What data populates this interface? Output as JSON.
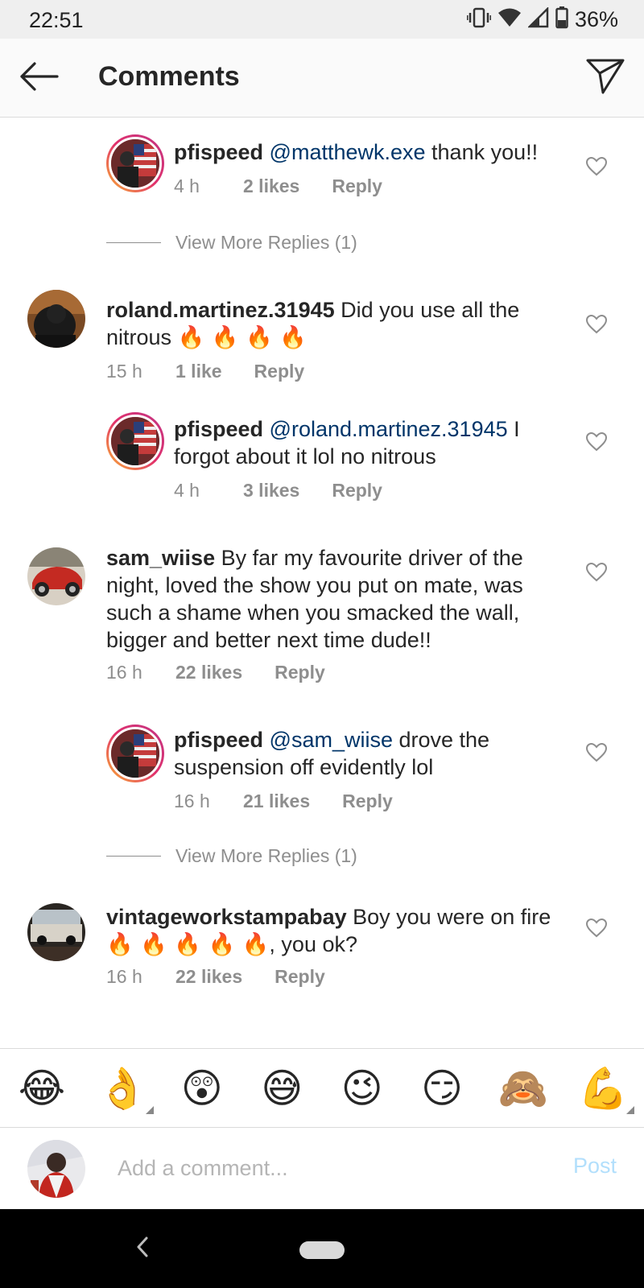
{
  "status_bar": {
    "time": "22:51",
    "battery": "36%",
    "icons": [
      "vibrate-icon",
      "wifi-icon",
      "signal-icon",
      "battery-icon"
    ]
  },
  "header": {
    "title": "Comments",
    "back_icon": "arrow-left-icon",
    "share_icon": "paper-plane-icon"
  },
  "comments": [
    {
      "user": "pfispeed",
      "mention": "@matthewk.exe",
      "text": " thank you!!",
      "time": "4 h",
      "likes": "2 likes",
      "reply": "Reply"
    },
    {
      "more_replies": "View More Replies (1)"
    },
    {
      "user": "roland.martinez.31945",
      "text": "Did you use all the nitrous",
      "emoji": "🔥 🔥 🔥 🔥",
      "time": "15 h",
      "likes": "1 like",
      "reply": "Reply"
    },
    {
      "user": "pfispeed",
      "mention": "@roland.martinez.31945",
      "text": " I forgot about it lol no nitrous",
      "time": "4 h",
      "likes": "3 likes",
      "reply": "Reply"
    },
    {
      "user": "sam_wiise",
      "text": "By far my favourite driver of the night, loved the show you put on mate, was such a shame when you smacked the wall, bigger and better next time dude!!",
      "time": "16 h",
      "likes": "22 likes",
      "reply": "Reply"
    },
    {
      "user": "pfispeed",
      "mention": "@sam_wiise",
      "text": " drove the suspension off evidently lol",
      "time": "16 h",
      "likes": "21 likes",
      "reply": "Reply"
    },
    {
      "more_replies": "View More Replies (1)"
    },
    {
      "user": "vintageworkstampabay",
      "text": "Boy you were on fire",
      "emoji": "🔥 🔥 🔥 🔥 🔥",
      "text_after": ", you ok?",
      "time": "16 h",
      "likes": "22 likes",
      "reply": "Reply"
    }
  ],
  "emoji_bar": [
    "😂",
    "👌",
    "😲",
    "😅",
    "😉",
    "😏",
    "🙈",
    "💪"
  ],
  "input": {
    "placeholder": "Add a comment...",
    "post_label": "Post"
  },
  "colors": {
    "mention": "#003569",
    "meta": "#8e8e8e",
    "post_disabled": "#b2dffc",
    "ring_gradient": [
      "#f9b233",
      "#e1306c",
      "#c13584"
    ]
  }
}
